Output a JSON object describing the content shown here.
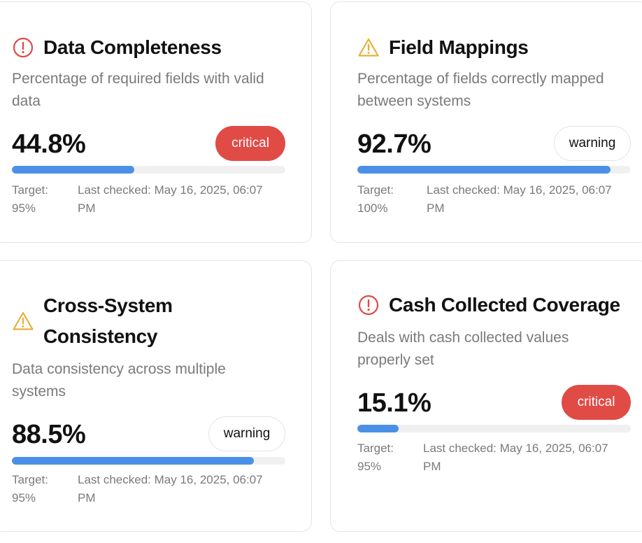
{
  "colors": {
    "critical": "#e04b46",
    "warning_icon": "#e8b03a",
    "progress": "#4a90e6",
    "track": "#f0f0f0"
  },
  "cards": [
    {
      "title": "Data Completeness",
      "icon": "alert-circle-icon",
      "description": "Percentage of required fields with valid data",
      "value": "44.8%",
      "progress": 0.448,
      "status": "critical",
      "target_label": "Target:",
      "target_value": "95%",
      "last_checked_label": "Last checked:",
      "last_checked_value": "May 16, 2025, 06:07 PM"
    },
    {
      "title": "Field Mappings",
      "icon": "alert-triangle-icon",
      "description": "Percentage of fields correctly mapped between systems",
      "value": "92.7%",
      "progress": 0.927,
      "status": "warning",
      "target_label": "Target:",
      "target_value": "100%",
      "last_checked_label": "Last checked:",
      "last_checked_value": "May 16, 2025, 06:07 PM"
    },
    {
      "title": "Cross-System Consistency",
      "icon": "alert-triangle-icon",
      "description": "Data consistency across multiple systems",
      "value": "88.5%",
      "progress": 0.885,
      "status": "warning",
      "target_label": "Target:",
      "target_value": "95%",
      "last_checked_label": "Last checked:",
      "last_checked_value": "May 16, 2025, 06:07 PM"
    },
    {
      "title": "Cash Collected Coverage",
      "icon": "alert-circle-icon",
      "description": "Deals with cash collected values properly set",
      "value": "15.1%",
      "progress": 0.151,
      "status": "critical",
      "target_label": "Target:",
      "target_value": "95%",
      "last_checked_label": "Last checked:",
      "last_checked_value": "May 16, 2025, 06:07 PM"
    }
  ]
}
